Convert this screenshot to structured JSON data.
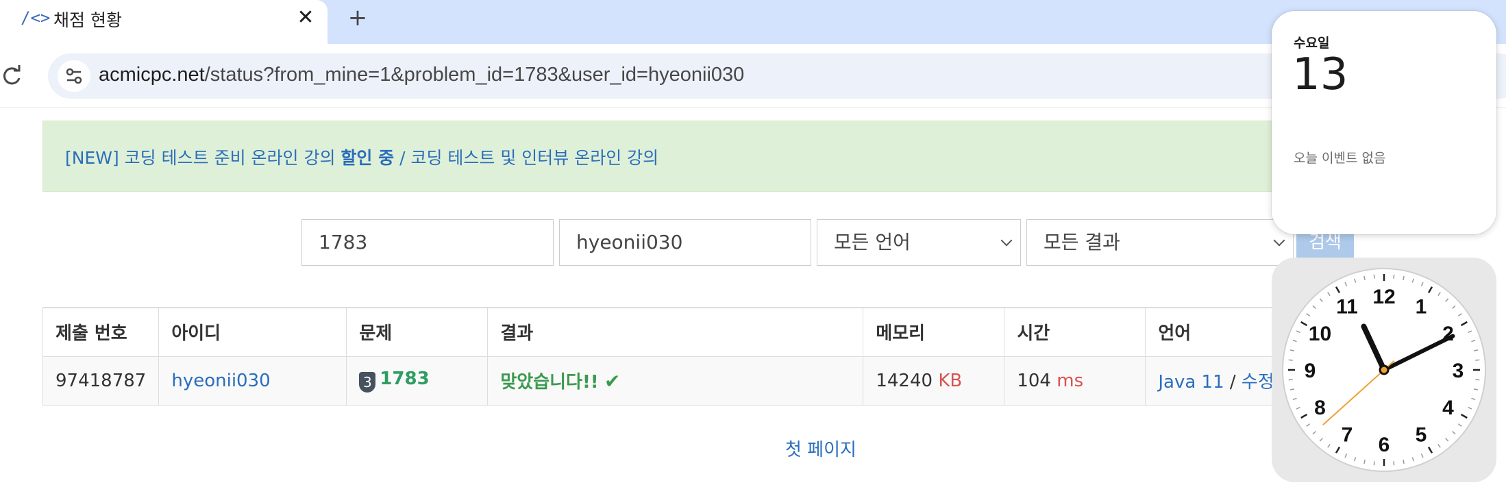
{
  "browser": {
    "tab": {
      "favicon": "/<>",
      "title": "채점 현황",
      "close": "✕"
    },
    "new_tab": "+",
    "url_host": "acmicpc.net",
    "url_path": "/status?from_mine=1&problem_id=1783&user_id=hyeonii030"
  },
  "notice": {
    "part1": "[NEW] 코딩 테스트 준비 온라인 강의 ",
    "bold": "할인 중",
    "part2": " / 코딩 테스트 및 인터뷰 온라인 강의"
  },
  "filters": {
    "problem_id": "1783",
    "user_id": "hyeonii030",
    "language": "모든 언어",
    "result": "모든 결과",
    "search_label": "검색"
  },
  "table": {
    "headers": [
      "제출 번호",
      "아이디",
      "문제",
      "결과",
      "메모리",
      "시간",
      "언어"
    ],
    "rows": [
      {
        "submission_id": "97418787",
        "user": "hyeonii030",
        "tier_badge": "3",
        "problem": "1783",
        "result": "맞았습니다!!",
        "result_mark": "✔",
        "memory": "14240",
        "memory_unit": "KB",
        "time": "104",
        "time_unit": "ms",
        "language": "Java 11",
        "separator": "/",
        "edit": "수정"
      }
    ]
  },
  "pager": {
    "first_page": "첫 페이지"
  },
  "calendar_widget": {
    "weekday": "수요일",
    "day": "13",
    "events": "오늘 이벤트 없음"
  },
  "clock_widget": {
    "numbers": [
      "12",
      "1",
      "2",
      "3",
      "4",
      "5",
      "6",
      "7",
      "8",
      "9",
      "10",
      "11"
    ],
    "time": {
      "hour": 11,
      "minute": 10,
      "second": 38
    },
    "second_hand_color": "#f0a030"
  },
  "colors": {
    "link": "#2a6ebb",
    "accent_green": "#3c9a4e",
    "unit_red": "#d9534f",
    "notice_bg": "#dff0d8"
  }
}
